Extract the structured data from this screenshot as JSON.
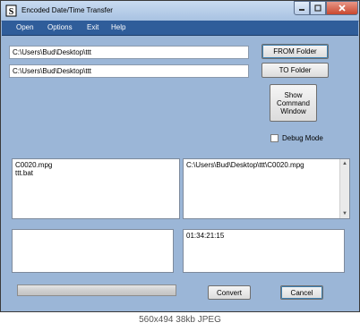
{
  "window": {
    "title": "Encoded Date/Time Transfer"
  },
  "menu": [
    "Open",
    "Options",
    "Exit",
    "Help"
  ],
  "from_path": "C:\\Users\\Bud\\Desktop\\ttt",
  "to_path": "C:\\Users\\Bud\\Desktop\\ttt",
  "buttons": {
    "from_folder": "FROM Folder",
    "to_folder": "TO Folder",
    "show_command": "Show\nCommand\nWindow",
    "convert": "Convert",
    "cancel": "Cancel"
  },
  "debug_label": "Debug Mode",
  "debug_checked": false,
  "file_list": [
    "C0020.mpg",
    "ttt.bat"
  ],
  "target_list": [
    "C:\\Users\\Bud\\Desktop\\ttt\\C0020.mpg"
  ],
  "timestamp": "01:34:21:15",
  "progress": 0,
  "caption": "560x494  38kb  JPEG",
  "colors": {
    "window_bg": "#9bb6d7",
    "menubar": "#2f5d9a",
    "close_button": "#c9482f"
  }
}
